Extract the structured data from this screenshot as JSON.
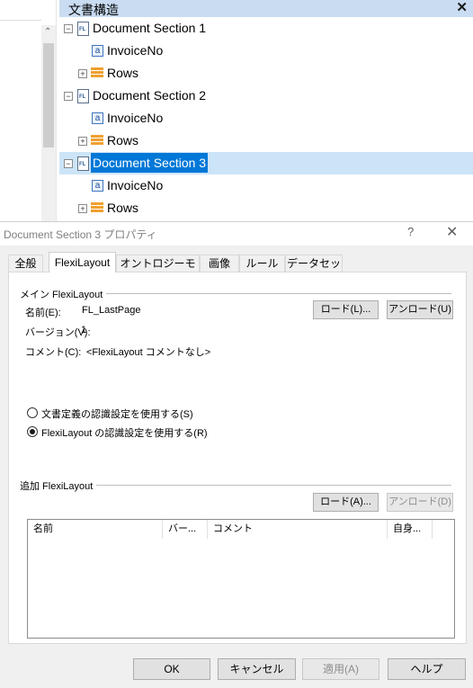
{
  "tree_panel": {
    "title": "文書構造",
    "nodes": [
      {
        "label": "Document Section 1"
      },
      {
        "label": "InvoiceNo"
      },
      {
        "label": "Rows"
      },
      {
        "label": "Document Section 2"
      },
      {
        "label": "InvoiceNo"
      },
      {
        "label": "Rows"
      },
      {
        "label": "Document Section 3",
        "selected": true
      },
      {
        "label": "InvoiceNo"
      },
      {
        "label": "Rows"
      }
    ]
  },
  "dialog": {
    "title": "Document Section 3 プロパティ",
    "help": "?",
    "tabs": [
      "全般",
      "FlexiLayout",
      "オントロジーモデル",
      "画像",
      "ルール",
      "データセット"
    ],
    "active_tab": "FlexiLayout",
    "main_group": {
      "label": "メイン FlexiLayout",
      "name_label": "名前(E):",
      "name_value": "FL_LastPage",
      "version_label": "バージョン(V):",
      "version_value": "1",
      "comment_label": "コメント(C):",
      "comment_value": "<FlexiLayout コメントなし>",
      "load_button": "ロード(L)...",
      "unload_button": "アンロード(U)"
    },
    "recognition": {
      "option1": "文書定義の認識設定を使用する(S)",
      "option2": "FlexiLayout の認識設定を使用する(R)",
      "selected": "option2"
    },
    "additional_group": {
      "label": "追加 FlexiLayout",
      "load_button": "ロード(A)...",
      "unload_button": "アンロード(D)",
      "columns": [
        "名前",
        "バー...",
        "コメント",
        "自身..."
      ]
    },
    "footer": {
      "ok": "OK",
      "cancel": "キャンセル",
      "apply": "適用(A)",
      "help": "ヘルプ"
    }
  }
}
